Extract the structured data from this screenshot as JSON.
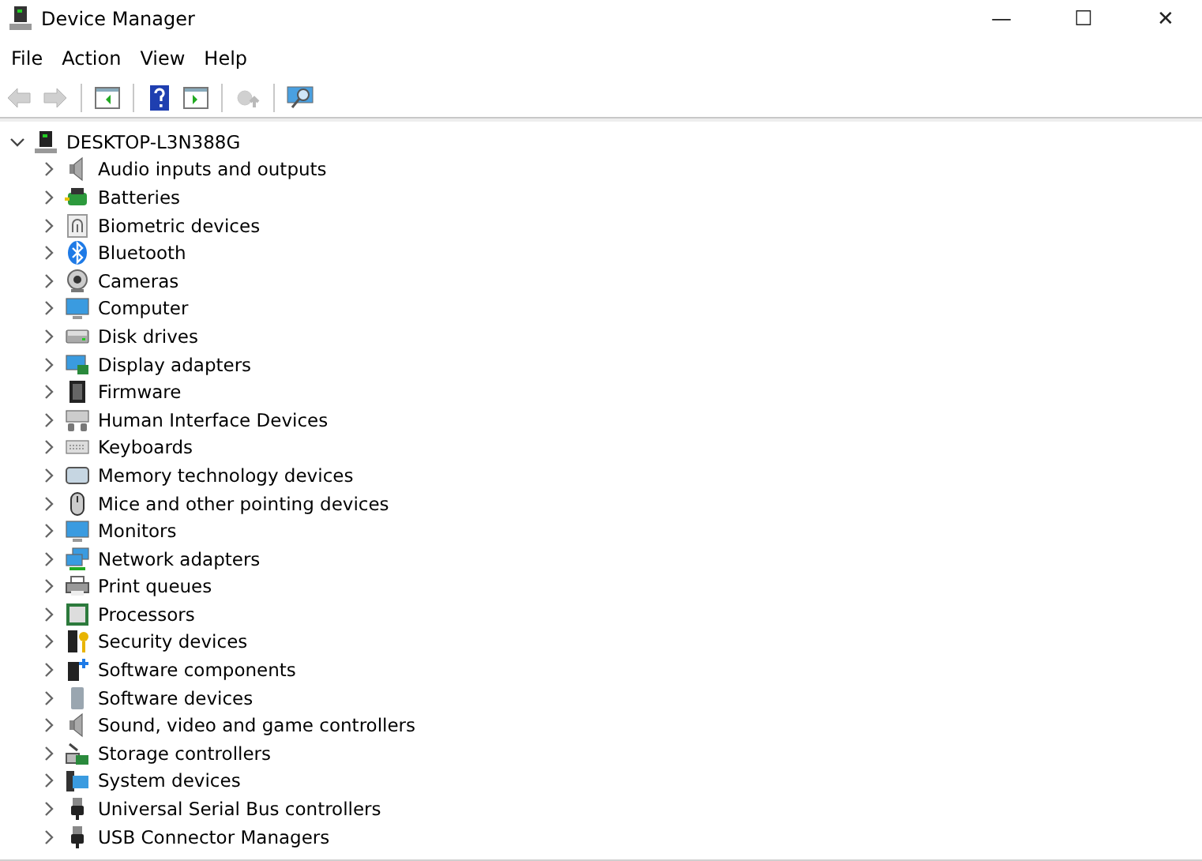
{
  "window": {
    "title": "Device Manager",
    "controls": [
      "—",
      "☐",
      "✕"
    ]
  },
  "menu": [
    {
      "label": "File"
    },
    {
      "label": "Action"
    },
    {
      "label": "View"
    },
    {
      "label": "Help"
    }
  ],
  "toolbar": [
    {
      "kind": "back",
      "disabled": true
    },
    {
      "kind": "forward",
      "disabled": true
    },
    {
      "kind": "sep"
    },
    {
      "kind": "console",
      "disabled": false
    },
    {
      "kind": "sep"
    },
    {
      "kind": "help",
      "disabled": false
    },
    {
      "kind": "pane",
      "disabled": false
    },
    {
      "kind": "sep"
    },
    {
      "kind": "update",
      "disabled": true
    },
    {
      "kind": "sep"
    },
    {
      "kind": "scan",
      "disabled": false
    }
  ],
  "tree": {
    "label": "DESKTOP-L3N388G",
    "expanded": true,
    "children": [
      {
        "label": "Audio inputs and outputs",
        "expanded": false
      },
      {
        "label": "Batteries",
        "expanded": false
      },
      {
        "label": "Biometric devices",
        "expanded": false
      },
      {
        "label": "Bluetooth",
        "expanded": false
      },
      {
        "label": "Cameras",
        "expanded": false
      },
      {
        "label": "Computer",
        "expanded": false
      },
      {
        "label": "Disk drives",
        "expanded": false
      },
      {
        "label": "Display adapters",
        "expanded": false
      },
      {
        "label": "Firmware",
        "expanded": false
      },
      {
        "label": "Human Interface Devices",
        "expanded": false
      },
      {
        "label": "Keyboards",
        "expanded": false
      },
      {
        "label": "Memory technology devices",
        "expanded": false
      },
      {
        "label": "Mice and other pointing devices",
        "expanded": false
      },
      {
        "label": "Monitors",
        "expanded": false
      },
      {
        "label": "Network adapters",
        "expanded": false
      },
      {
        "label": "Print queues",
        "expanded": false
      },
      {
        "label": "Processors",
        "expanded": false
      },
      {
        "label": "Security devices",
        "expanded": false
      },
      {
        "label": "Software components",
        "expanded": false
      },
      {
        "label": "Software devices",
        "expanded": false
      },
      {
        "label": "Sound, video and game controllers",
        "expanded": false
      },
      {
        "label": "Storage controllers",
        "expanded": false
      },
      {
        "label": "System devices",
        "expanded": false
      },
      {
        "label": "Universal Serial Bus controllers",
        "expanded": false
      },
      {
        "label": "USB Connector Managers",
        "expanded": false
      }
    ]
  }
}
